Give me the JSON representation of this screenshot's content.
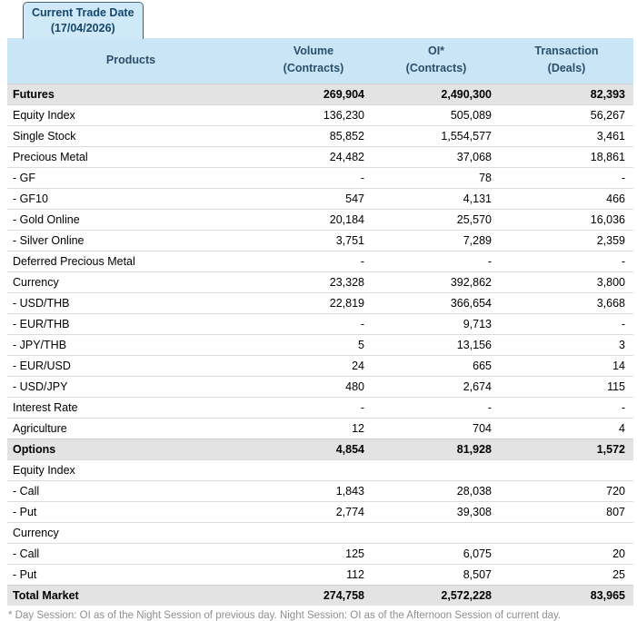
{
  "tab": {
    "line1": "Current Trade Date",
    "line2": "(17/04/2026)"
  },
  "table": {
    "columns": [
      {
        "label": "Products",
        "sub": ""
      },
      {
        "label": "Volume",
        "sub": "(Contracts)"
      },
      {
        "label": "OI*",
        "sub": "(Contracts)"
      },
      {
        "label": "Transaction",
        "sub": "(Deals)"
      }
    ],
    "rows": [
      {
        "product": "Futures",
        "volume": "269,904",
        "oi": "2,490,300",
        "transaction": "82,393",
        "type": "section"
      },
      {
        "product": "Equity Index",
        "volume": "136,230",
        "oi": "505,089",
        "transaction": "56,267",
        "type": "normal"
      },
      {
        "product": "Single Stock",
        "volume": "85,852",
        "oi": "1,554,577",
        "transaction": "3,461",
        "type": "normal"
      },
      {
        "product": "Precious Metal",
        "volume": "24,482",
        "oi": "37,068",
        "transaction": "18,861",
        "type": "normal"
      },
      {
        "product": "- GF",
        "volume": "-",
        "oi": "78",
        "transaction": "-",
        "type": "normal"
      },
      {
        "product": "- GF10",
        "volume": "547",
        "oi": "4,131",
        "transaction": "466",
        "type": "normal"
      },
      {
        "product": "- Gold Online",
        "volume": "20,184",
        "oi": "25,570",
        "transaction": "16,036",
        "type": "normal"
      },
      {
        "product": "- Silver Online",
        "volume": "3,751",
        "oi": "7,289",
        "transaction": "2,359",
        "type": "normal"
      },
      {
        "product": "Deferred Precious Metal",
        "volume": "-",
        "oi": "-",
        "transaction": "-",
        "type": "normal"
      },
      {
        "product": "Currency",
        "volume": "23,328",
        "oi": "392,862",
        "transaction": "3,800",
        "type": "normal"
      },
      {
        "product": "- USD/THB",
        "volume": "22,819",
        "oi": "366,654",
        "transaction": "3,668",
        "type": "normal"
      },
      {
        "product": "- EUR/THB",
        "volume": "-",
        "oi": "9,713",
        "transaction": "-",
        "type": "normal"
      },
      {
        "product": "- JPY/THB",
        "volume": "5",
        "oi": "13,156",
        "transaction": "3",
        "type": "normal"
      },
      {
        "product": "- EUR/USD",
        "volume": "24",
        "oi": "665",
        "transaction": "14",
        "type": "normal"
      },
      {
        "product": "- USD/JPY",
        "volume": "480",
        "oi": "2,674",
        "transaction": "115",
        "type": "normal"
      },
      {
        "product": "Interest Rate",
        "volume": "-",
        "oi": "-",
        "transaction": "-",
        "type": "normal"
      },
      {
        "product": "Agriculture",
        "volume": "12",
        "oi": "704",
        "transaction": "4",
        "type": "normal"
      },
      {
        "product": "Options",
        "volume": "4,854",
        "oi": "81,928",
        "transaction": "1,572",
        "type": "section"
      },
      {
        "product": "Equity Index",
        "volume": "",
        "oi": "",
        "transaction": "",
        "type": "group"
      },
      {
        "product": "- Call",
        "volume": "1,843",
        "oi": "28,038",
        "transaction": "720",
        "type": "normal"
      },
      {
        "product": "- Put",
        "volume": "2,774",
        "oi": "39,308",
        "transaction": "807",
        "type": "normal"
      },
      {
        "product": "Currency",
        "volume": "",
        "oi": "",
        "transaction": "",
        "type": "group"
      },
      {
        "product": "- Call",
        "volume": "125",
        "oi": "6,075",
        "transaction": "20",
        "type": "normal"
      },
      {
        "product": "- Put",
        "volume": "112",
        "oi": "8,507",
        "transaction": "25",
        "type": "normal"
      },
      {
        "product": "Total Market",
        "volume": "274,758",
        "oi": "2,572,228",
        "transaction": "83,965",
        "type": "section"
      }
    ]
  },
  "footnote": "* Day Session: OI as of the Night Session of previous day. Night Session: OI as of the Afternoon Session of current day.",
  "colors": {
    "tab_bg": "#cfe9f9",
    "tab_border": "#44617a",
    "tab_text": "#15466b",
    "header_bg": "#c9e5f6",
    "header_text": "#2b4f6b",
    "section_row_bg": "#e3e3e3",
    "row_divider": "#dcdcdc",
    "footnote_text": "#8f8f8f"
  }
}
